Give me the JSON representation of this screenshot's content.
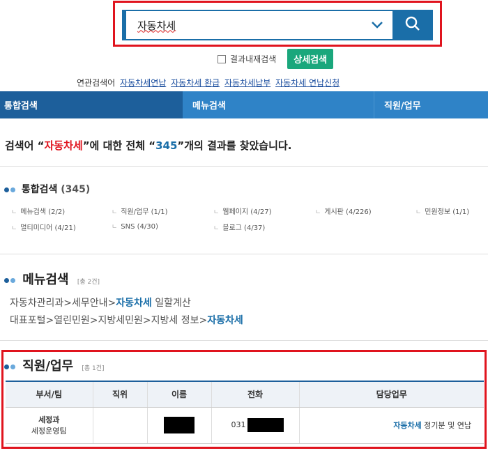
{
  "search": {
    "query": "자동차세",
    "within_label": "결과내재검색",
    "detail_button": "상세검색"
  },
  "related": {
    "label": "연관검색어",
    "items": [
      "자동차세연납",
      "자동차세 환급",
      "자동차세납부",
      "자동차세 연납신청"
    ]
  },
  "tabs": [
    "통합검색",
    "메뉴검색",
    "직원/업무"
  ],
  "summary": {
    "prefix": "검색어 “",
    "keyword": "자동차세",
    "middle": "”에 대한 전체 “",
    "count": "345",
    "suffix": "”개의 결과를 찾았습니다."
  },
  "integrated": {
    "title": "통합검색",
    "count": "(345)",
    "categories": [
      "메뉴검색 (2/2)",
      "직원/업무 (1/1)",
      "웹페이지 (4/27)",
      "게시판 (4/226)",
      "민원정보 (1/1)",
      "멀티미디어 (4/21)",
      "SNS (4/30)",
      "블로그 (4/37)"
    ]
  },
  "menu_search": {
    "title": "메뉴검색",
    "count": "[총 2건]",
    "paths": [
      {
        "prefix": "자동차관리과>세무안내>",
        "keyword": "자동차세",
        "suffix": " 일할계산"
      },
      {
        "prefix": "대표포털>열린민원>지방세민원>지방세 정보>",
        "keyword": "자동차세",
        "suffix": ""
      }
    ]
  },
  "staff": {
    "title": "직원/업무",
    "count": "[총 1건]",
    "headers": [
      "부서/팀",
      "직위",
      "이름",
      "전화",
      "담당업무"
    ],
    "row": {
      "dept": "세정과",
      "team": "세정운영팀",
      "position": "",
      "phone_prefix": "031",
      "duty_keyword": "자동차세",
      "duty_rest": " 정기분 및 연납"
    }
  },
  "colors": {
    "primary": "#1d5f9b",
    "tab": "#2f83c7",
    "highlight": "#e0141e",
    "green": "#1aa77c"
  }
}
